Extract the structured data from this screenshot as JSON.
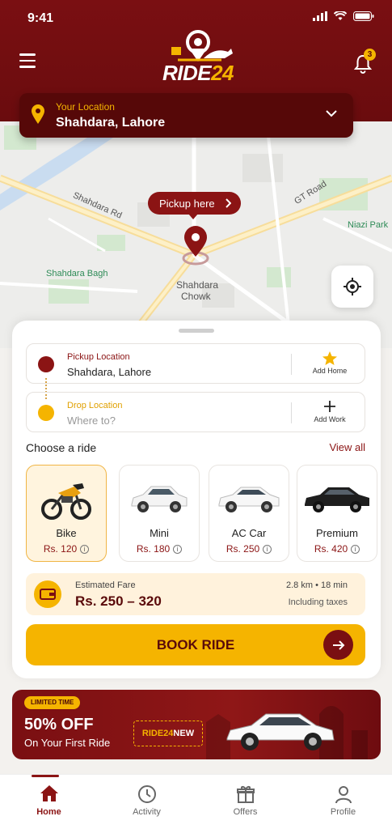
{
  "status_bar": {
    "time": "9:41"
  },
  "header": {
    "logo_text_main": "RIDE",
    "logo_text_accent": "24",
    "notification_count": "3"
  },
  "location": {
    "label": "Your Location",
    "value": "Shahdara, Lahore"
  },
  "map": {
    "labels": [
      "Shahdara Rd",
      "GT Road",
      "Niazi Park",
      "Shahdara Bagh",
      "Shahdara",
      "Chowk"
    ],
    "pickup_bubble": "Pickup here"
  },
  "route": {
    "pickup_label": "Pickup Location",
    "pickup_value": "Shahdara, Lahore",
    "pickup_action": "Add Home",
    "drop_label": "Drop Location",
    "drop_placeholder": "Where to?",
    "drop_action": "Add Work"
  },
  "rides": {
    "heading": "Choose a ride",
    "view_all": "View all",
    "options": [
      {
        "name": "Bike",
        "price": "Rs. 120",
        "selected": true
      },
      {
        "name": "Mini",
        "price": "Rs. 180",
        "selected": false
      },
      {
        "name": "AC Car",
        "price": "Rs. 250",
        "selected": false
      },
      {
        "name": "Premium",
        "price": "Rs. 420",
        "selected": false
      }
    ]
  },
  "fare": {
    "label": "Estimated Fare",
    "value": "Rs.  250 – 320",
    "meta": "2.8 km  •  18 min",
    "taxes": "Including taxes"
  },
  "book_button": "BOOK RIDE",
  "promo": {
    "tag": "LIMITED TIME",
    "title": "50% OFF",
    "subtitle": "On Your First Ride",
    "code_accent": "RIDE24",
    "code_rest": "NEW"
  },
  "tabs": [
    {
      "label": "Home",
      "active": true
    },
    {
      "label": "Activity",
      "active": false
    },
    {
      "label": "Offers",
      "active": false
    },
    {
      "label": "Profile",
      "active": false
    }
  ],
  "colors": {
    "brand": "#7a0f12",
    "accent": "#f5b400"
  }
}
